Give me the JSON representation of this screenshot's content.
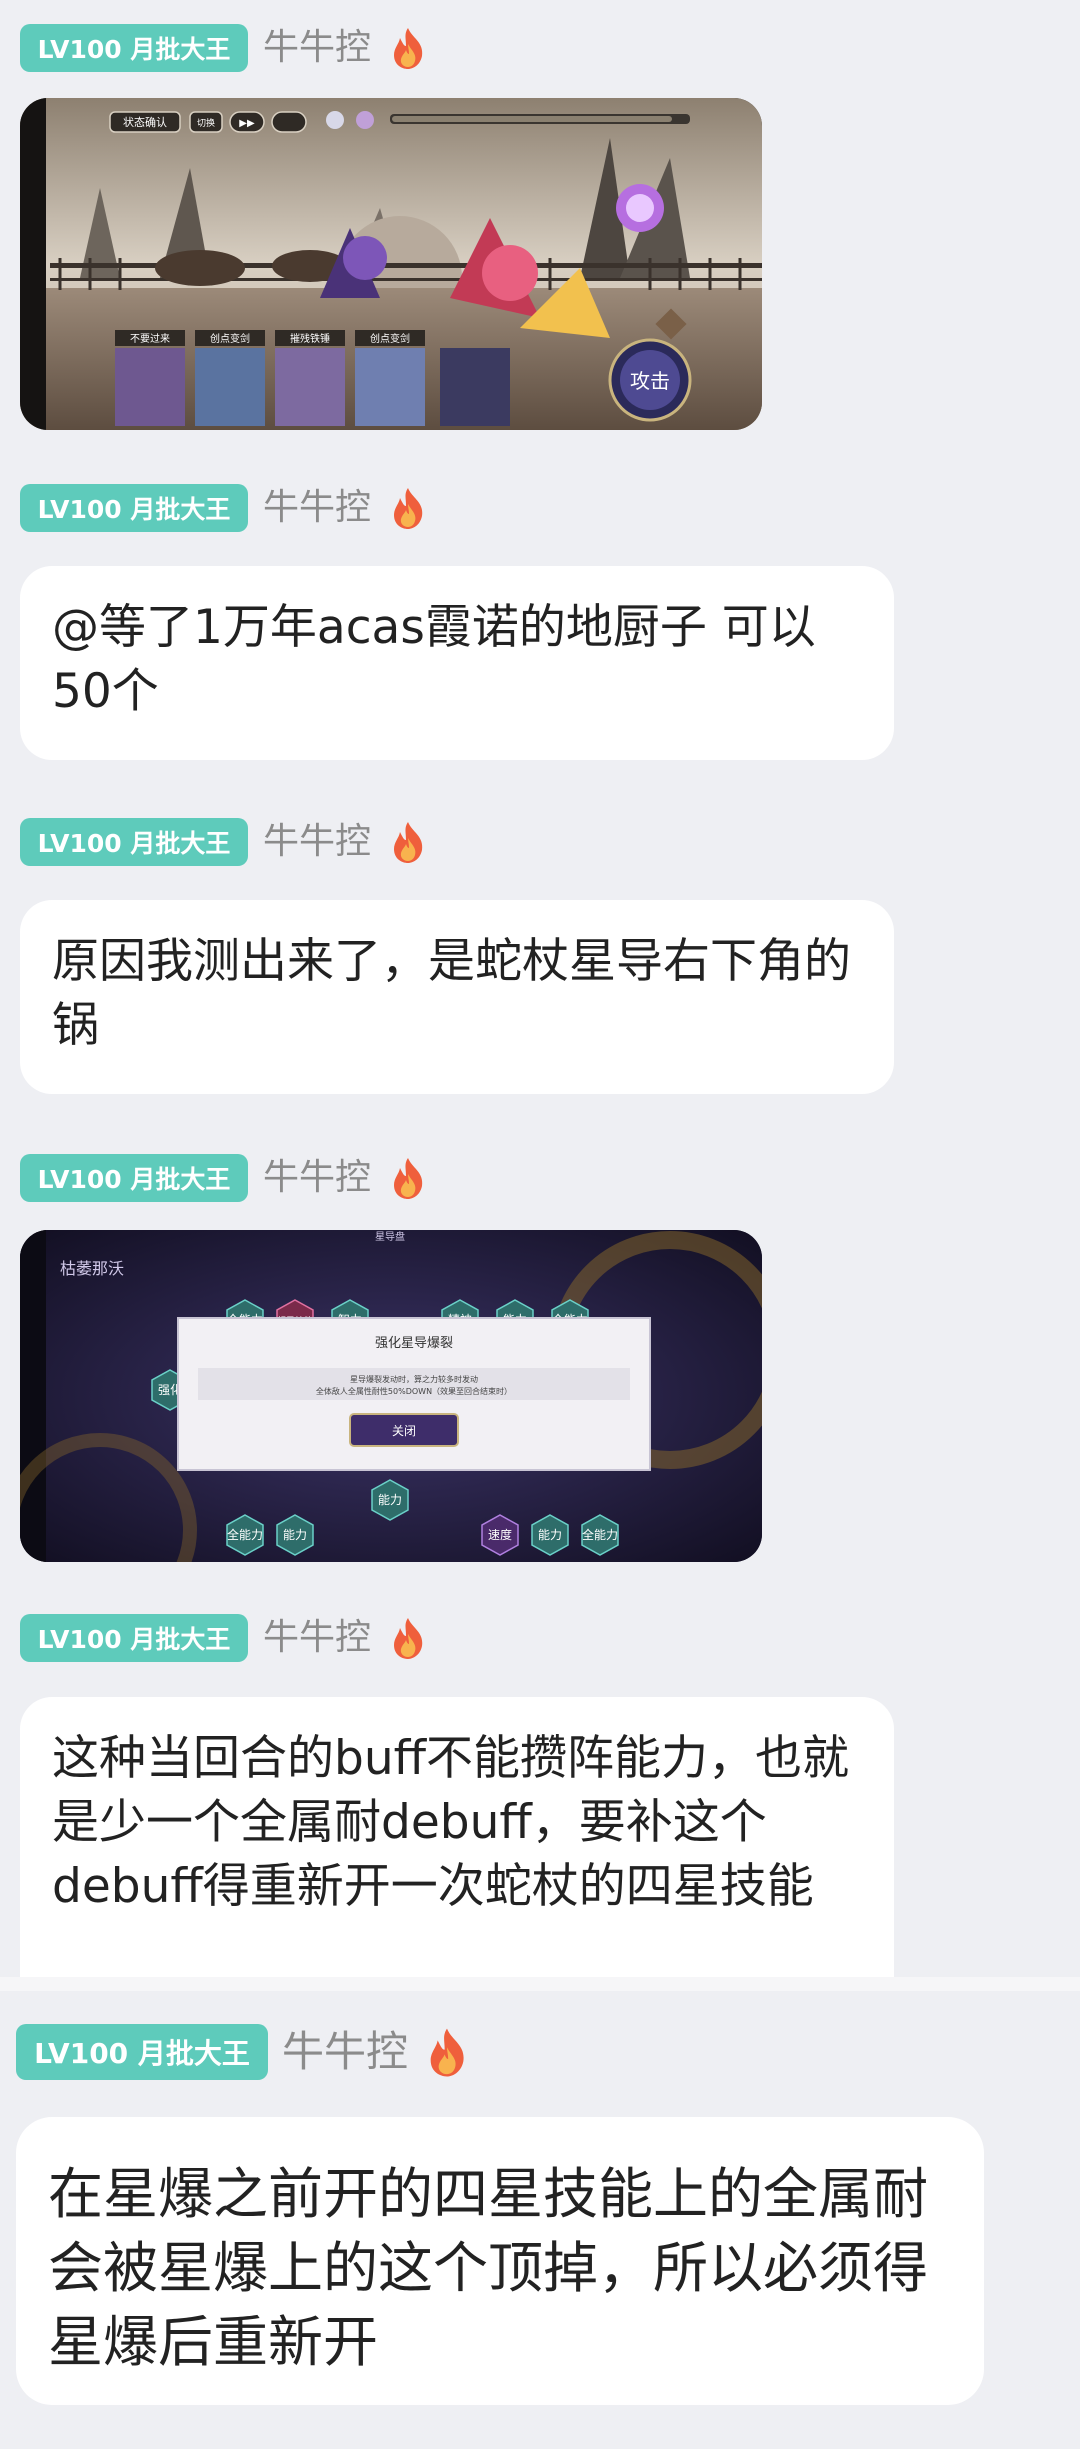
{
  "messages": [
    {
      "badge": "LV100 月批大王",
      "nickname": "牛牛控",
      "type": "image",
      "image": {
        "kind": "game-battle-screenshot",
        "top_buttons": [
          "状态确认",
          "切换",
          "▶▶",
          ""
        ],
        "bottom_labels": [
          "不要过来",
          "创点变剑",
          "摧残铁锤",
          "创点变剑"
        ],
        "attack_button": "攻击"
      }
    },
    {
      "badge": "LV100 月批大王",
      "nickname": "牛牛控",
      "type": "text",
      "text": "@等了1万年acas霞诺的地厨子 可以50个"
    },
    {
      "badge": "LV100 月批大王",
      "nickname": "牛牛控",
      "type": "text",
      "text": "原因我测出来了，是蛇杖星导右下角的锅"
    },
    {
      "badge": "LV100 月批大王",
      "nickname": "牛牛控",
      "type": "image",
      "image": {
        "kind": "game-dialog-screenshot",
        "header": "星导盘",
        "corner_text": "枯萎那沃",
        "dialog_title": "强化星导爆裂",
        "dialog_line1": "星导爆裂发动时，算之力较多时发动",
        "dialog_line2": "全体敌人全属性耐性50%DOWN（效果至回合结束时）",
        "dialog_button": "关闭",
        "hex_labels": [
          "全能力",
          "超导技能",
          "智力",
          "精神",
          "能力",
          "全能力",
          "强化",
          "强化",
          "能力",
          "全能力",
          "能力",
          "速度",
          "能力",
          "全能力"
        ]
      }
    },
    {
      "badge": "LV100 月批大王",
      "nickname": "牛牛控",
      "type": "text",
      "text": "这种当回合的buff不能攒阵能力，也就是少一个全属耐debuff，要补这个debuff得重新开一次蛇杖的四星技能"
    },
    {
      "badge": "LV100 月批大王",
      "nickname": "牛牛控",
      "type": "text",
      "text": "在星爆之前开的四星技能上的全属耐会被星爆上的这个顶掉，所以必须得星爆后重新开"
    }
  ],
  "icons": {
    "level_flame": "fire-icon"
  },
  "colors": {
    "badge_bg": "#5ecbbb",
    "page_bg": "#eeeff3",
    "bubble_bg": "#ffffff",
    "nickname": "#8b8b8b",
    "flame_outer": "#ef5f3c",
    "flame_inner": "#f8b34e"
  }
}
